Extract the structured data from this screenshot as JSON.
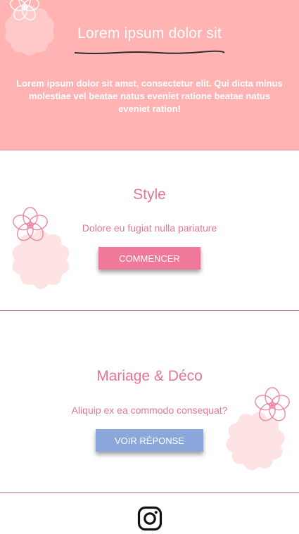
{
  "hero": {
    "title": "Lorem ipsum dolor sit",
    "text": "Lorem ipsum dolor sit amet, consectetur elit. Qui dicta minus molestiae vel beatae natus eveniet ratione beatae natus eveniet ration!"
  },
  "sections": [
    {
      "title": "Style",
      "subtitle": "Dolore eu fugiat nulla pariature",
      "button_label": "COMMENCER"
    },
    {
      "title": "Mariage & Déco",
      "subtitle": "Aliquip ex ea commodo consequat?",
      "button_label": "VOIR RÉPONSE"
    }
  ],
  "footer": {
    "icon": "instagram-icon"
  },
  "colors": {
    "hero_bg": "#ffb3b3",
    "accent_pink": "#f07898",
    "accent_blue": "#8aa8dc",
    "divider": "#c85a9a",
    "heading": "#e7758f"
  }
}
